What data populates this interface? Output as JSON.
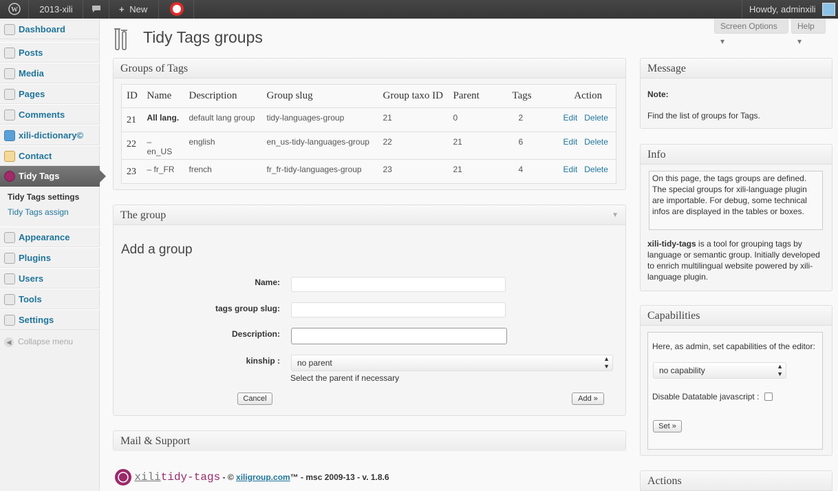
{
  "adminbar": {
    "site": "2013-xili",
    "new": "New",
    "howdy": "Howdy, adminxili"
  },
  "sidebar": {
    "items": [
      {
        "label": "Dashboard",
        "icon": "dashboard-icon"
      },
      {
        "label": "Posts",
        "icon": "pin-icon"
      },
      {
        "label": "Media",
        "icon": "media-icon"
      },
      {
        "label": "Pages",
        "icon": "pages-icon"
      },
      {
        "label": "Comments",
        "icon": "comments-icon"
      },
      {
        "label": "xili-dictionary©",
        "icon": "dictionary-icon"
      },
      {
        "label": "Contact",
        "icon": "contact-icon"
      },
      {
        "label": "Tidy Tags",
        "icon": "tidy-tags-icon"
      }
    ],
    "submenu": [
      "Tidy Tags settings",
      "Tidy Tags assign"
    ],
    "items2": [
      {
        "label": "Appearance",
        "icon": "appearance-icon"
      },
      {
        "label": "Plugins",
        "icon": "plugins-icon"
      },
      {
        "label": "Users",
        "icon": "users-icon"
      },
      {
        "label": "Tools",
        "icon": "tools-icon"
      },
      {
        "label": "Settings",
        "icon": "settings-icon"
      }
    ],
    "collapse": "Collapse menu"
  },
  "header": {
    "screen_options": "Screen Options ▾",
    "help": "Help ▾",
    "title": "Tidy Tags groups"
  },
  "groups_box": {
    "title": "Groups of Tags",
    "columns": [
      "ID",
      "Name",
      "Description",
      "Group slug",
      "Group taxo ID",
      "Parent",
      "Tags",
      "Action"
    ],
    "rows": [
      {
        "id": "21",
        "name": "All lang.",
        "description": "default lang group",
        "slug": "tidy-languages-group",
        "taxo": "21",
        "parent": "0",
        "tags": "2",
        "edit": "Edit",
        "delete": "Delete"
      },
      {
        "id": "22",
        "name": "– en_US",
        "description": "english",
        "slug": "en_us-tidy-languages-group",
        "taxo": "22",
        "parent": "21",
        "tags": "6",
        "edit": "Edit",
        "delete": "Delete"
      },
      {
        "id": "23",
        "name": "– fr_FR",
        "description": "french",
        "slug": "fr_fr-tidy-languages-group",
        "taxo": "23",
        "parent": "21",
        "tags": "4",
        "edit": "Edit",
        "delete": "Delete"
      }
    ]
  },
  "group_box": {
    "title": "The group",
    "subtitle": "Add a group",
    "name_label": "Name:",
    "slug_label": "tags group slug:",
    "description_label": "Description:",
    "kinship_label": "kinship :",
    "kinship_value": "no parent",
    "kinship_hint": "Select the parent if necessary",
    "cancel": "Cancel",
    "add": "Add »"
  },
  "mail_box": {
    "title": "Mail & Support"
  },
  "footer": {
    "brand_a": "xili",
    "brand_b": "tidy-tags",
    "text1": " - © ",
    "link": "xiligroup.com",
    "text2": "™ - msc 2009-13 - v. 1.8.6"
  },
  "message_box": {
    "title": "Message",
    "note": "Note:",
    "text": "Find the list of groups for Tags."
  },
  "info_box": {
    "title": "Info",
    "inner": "On this page, the tags groups are defined. The special groups for xili-language plugin are importable. For debug, some technical infos are displayed in the tables or boxes.",
    "brand": "xili-tidy-tags",
    "text": " is a tool for grouping tags by language or semantic group. Initially developed to enrich multilingual website powered by xili-language plugin."
  },
  "capabilities_box": {
    "title": "Capabilities",
    "intro": "Here, as admin, set capabilities of the editor:",
    "select_value": "no capability",
    "disable_label": "Disable Datatable javascript :",
    "set": "Set »"
  },
  "actions_box": {
    "title": "Actions"
  },
  "colors": {
    "link": "#21759b",
    "adminbar": "#464646",
    "active_menu": "#6a6a6a"
  }
}
